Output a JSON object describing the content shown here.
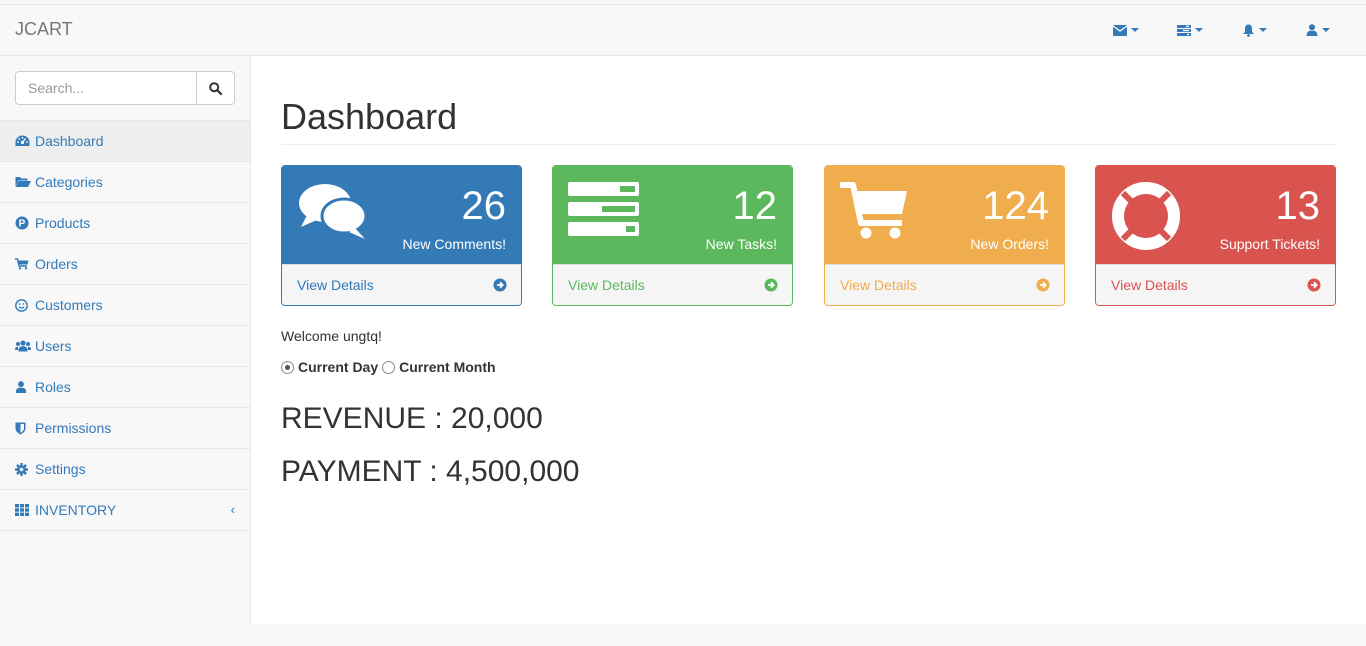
{
  "brand": "JCART",
  "topnav": [
    {
      "icon": "envelope-icon"
    },
    {
      "icon": "tasks-icon"
    },
    {
      "icon": "bell-icon"
    },
    {
      "icon": "user-icon"
    }
  ],
  "search": {
    "placeholder": "Search...",
    "value": ""
  },
  "sidebar": {
    "items": [
      {
        "label": "Dashboard",
        "icon": "dashboard-icon",
        "active": true
      },
      {
        "label": "Categories",
        "icon": "folder-open-icon"
      },
      {
        "label": "Products",
        "icon": "product-p-icon"
      },
      {
        "label": "Orders",
        "icon": "cart-icon"
      },
      {
        "label": "Customers",
        "icon": "smile-icon"
      },
      {
        "label": "Users",
        "icon": "users-icon"
      },
      {
        "label": "Roles",
        "icon": "user-icon"
      },
      {
        "label": "Permissions",
        "icon": "shield-icon"
      },
      {
        "label": "Settings",
        "icon": "gear-icon"
      },
      {
        "label": "INVENTORY",
        "icon": "grid-icon",
        "expandable": true
      }
    ]
  },
  "page": {
    "title": "Dashboard"
  },
  "panels": [
    {
      "count": "26",
      "text": "New Comments!",
      "link": "View Details",
      "color": "#337ab7",
      "icon": "comments-icon"
    },
    {
      "count": "12",
      "text": "New Tasks!",
      "link": "View Details",
      "color": "#5cb85c",
      "icon": "tasks-icon"
    },
    {
      "count": "124",
      "text": "New Orders!",
      "link": "View Details",
      "color": "#f0ad4e",
      "icon": "shopping-cart-icon"
    },
    {
      "count": "13",
      "text": "Support Tickets!",
      "link": "View Details",
      "color": "#d9534f",
      "icon": "support-icon"
    }
  ],
  "welcome": "Welcome ungtq!",
  "period": {
    "options": [
      "Current Day",
      "Current Month"
    ],
    "selected": "Current Day"
  },
  "revenue": "REVENUE : 20,000",
  "payment": "PAYMENT : 4,500,000"
}
